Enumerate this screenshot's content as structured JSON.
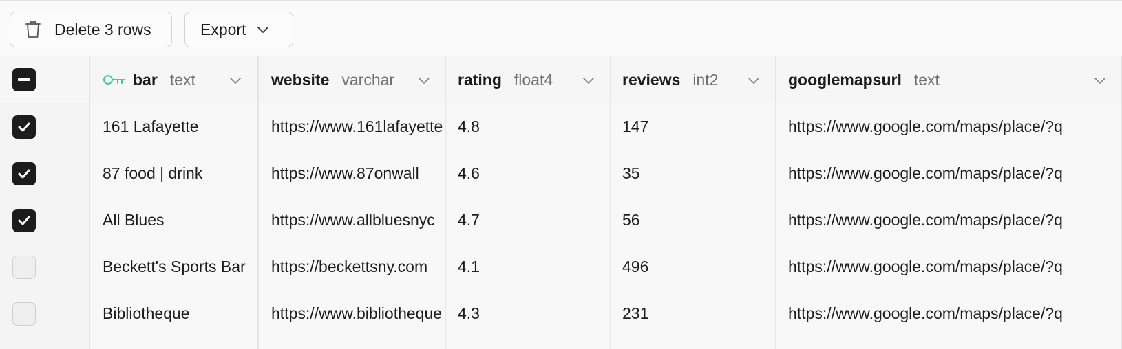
{
  "toolbar": {
    "delete_label": "Delete 3 rows",
    "export_label": "Export"
  },
  "columns": [
    {
      "name": "bar",
      "type": "text",
      "primary_key": true
    },
    {
      "name": "website",
      "type": "varchar"
    },
    {
      "name": "rating",
      "type": "float4"
    },
    {
      "name": "reviews",
      "type": "int2"
    },
    {
      "name": "googlemapsurl",
      "type": "text"
    }
  ],
  "rows": [
    {
      "selected": true,
      "bar": "161 Lafayette",
      "website": "https://www.161lafayette",
      "rating": "4.8",
      "reviews": "147",
      "googlemapsurl": "https://www.google.com/maps/place/?q"
    },
    {
      "selected": true,
      "bar": "87 food | drink",
      "website": "https://www.87onwall",
      "rating": "4.6",
      "reviews": "35",
      "googlemapsurl": "https://www.google.com/maps/place/?q"
    },
    {
      "selected": true,
      "bar": "All Blues",
      "website": "https://www.allbluesnyc",
      "rating": "4.7",
      "reviews": "56",
      "googlemapsurl": "https://www.google.com/maps/place/?q"
    },
    {
      "selected": false,
      "bar": "Beckett's Sports Bar",
      "website": "https://beckettsny.com",
      "rating": "4.1",
      "reviews": "496",
      "googlemapsurl": "https://www.google.com/maps/place/?q"
    },
    {
      "selected": false,
      "bar": "Bibliotheque",
      "website": "https://www.bibliotheque",
      "rating": "4.3",
      "reviews": "231",
      "googlemapsurl": "https://www.google.com/maps/place/?q"
    }
  ],
  "colors": {
    "key_icon": "#3ecf8e",
    "checkbox_checked": "#1c1c1c",
    "checkbox_unchecked": "#efefef"
  },
  "icons": {
    "delete": "trash-icon",
    "export": "chevron-down-icon",
    "primary_key": "key-icon",
    "select_all": "minus-checkbox-icon"
  }
}
